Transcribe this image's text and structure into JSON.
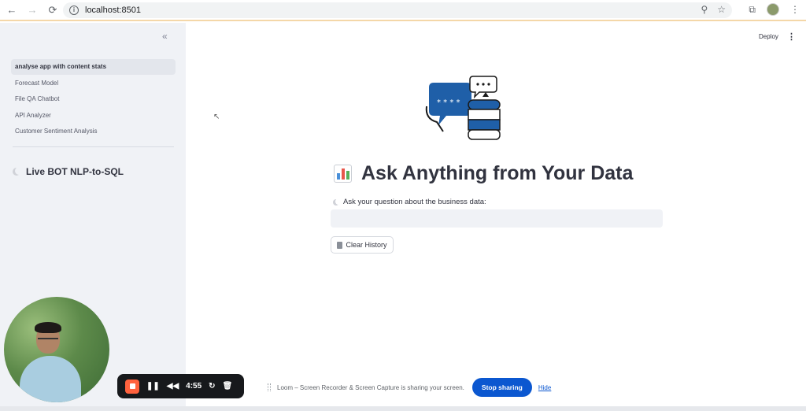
{
  "browser": {
    "url": "localhost:8501",
    "back_icon": "←",
    "forward_icon": "→",
    "reload_icon": "⟳"
  },
  "sidebar": {
    "collapse_icon": "«",
    "items": [
      {
        "label": "analyse app with content stats",
        "active": true
      },
      {
        "label": "Forecast Model"
      },
      {
        "label": "File QA Chatbot"
      },
      {
        "label": "API Analyzer"
      },
      {
        "label": "Customer Sentiment Analysis"
      }
    ],
    "section_title": "Live BOT NLP-to-SQL"
  },
  "header": {
    "deploy_label": "Deploy",
    "menu_icon": "⋮"
  },
  "main": {
    "title": "Ask Anything from Your Data",
    "question_label": "Ask your question about the business data:",
    "question_value": "",
    "clear_button_label": "Clear History"
  },
  "loom": {
    "timer": "4:55",
    "share_text": "Loom – Screen Recorder & Screen Capture is sharing your screen.",
    "stop_label": "Stop sharing",
    "hide_label": "Hide"
  },
  "colors": {
    "sidebar_bg": "#f0f2f6",
    "accent_blue": "#0b57d0",
    "record_orange": "#ff623e"
  }
}
